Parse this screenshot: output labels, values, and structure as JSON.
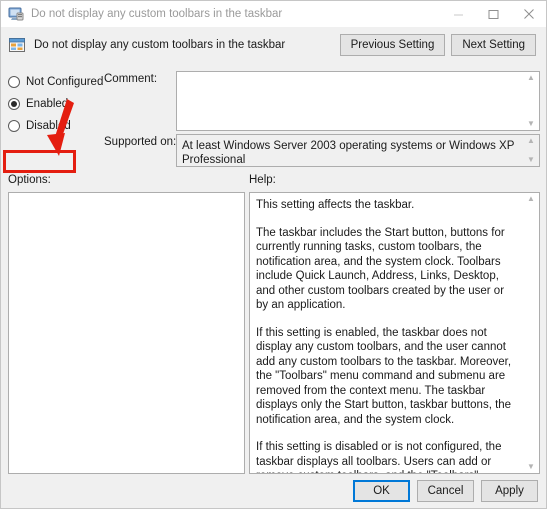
{
  "window": {
    "titlebar": {
      "icon": "policy-setting-window-icon",
      "title": "Do not display any custom toolbars in the taskbar",
      "controls": {
        "minimize": "minimize-icon",
        "maximize": "maximize-icon",
        "close": "close-icon"
      }
    },
    "header": {
      "icon": "policy-setting-icon",
      "title": "Do not display any custom toolbars in the taskbar",
      "previous_setting_label": "Previous Setting",
      "next_setting_label": "Next Setting"
    },
    "state": {
      "options": [
        {
          "label": "Not Configured",
          "checked": false
        },
        {
          "label": "Enabled",
          "checked": true
        },
        {
          "label": "Disabled",
          "checked": false
        }
      ],
      "selected": "Enabled"
    },
    "comment": {
      "label": "Comment:",
      "value": "",
      "scroll_up": "▲",
      "scroll_down": "▼"
    },
    "supported_on": {
      "label": "Supported on:",
      "value": "At least Windows Server 2003 operating systems or Windows XP Professional",
      "scroll_up": "▲",
      "scroll_down": "▼"
    },
    "options_pane": {
      "label": "Options:",
      "content": ""
    },
    "help_pane": {
      "label": "Help:",
      "paragraphs": [
        "This setting affects the taskbar.",
        "The taskbar includes the Start button, buttons for currently running tasks, custom toolbars, the notification area, and the system clock. Toolbars include Quick Launch, Address, Links, Desktop, and other custom toolbars created by the user or by an application.",
        "If this setting is enabled, the taskbar does not display any custom toolbars, and the user cannot add any custom toolbars to the taskbar. Moreover, the \"Toolbars\" menu command and submenu are removed from the context menu. The taskbar displays only the Start button, taskbar buttons, the notification area, and the system clock.",
        "If this setting is disabled or is not configured, the taskbar displays all toolbars. Users can add or remove custom toolbars, and the \"Toolbars\" command appears in the context menu."
      ],
      "scroll_up": "▲",
      "scroll_down": "▼"
    },
    "footer": {
      "ok_label": "OK",
      "cancel_label": "Cancel",
      "apply_label": "Apply"
    },
    "annotations": {
      "highlight_target": "Enabled",
      "arrow": "red-arrow-pointing-to-enabled",
      "color": "#e41e10"
    },
    "colors": {
      "accent": "#0078d7",
      "dialog_bg": "#f0f0f0",
      "annotation_red": "#e41e10"
    }
  }
}
